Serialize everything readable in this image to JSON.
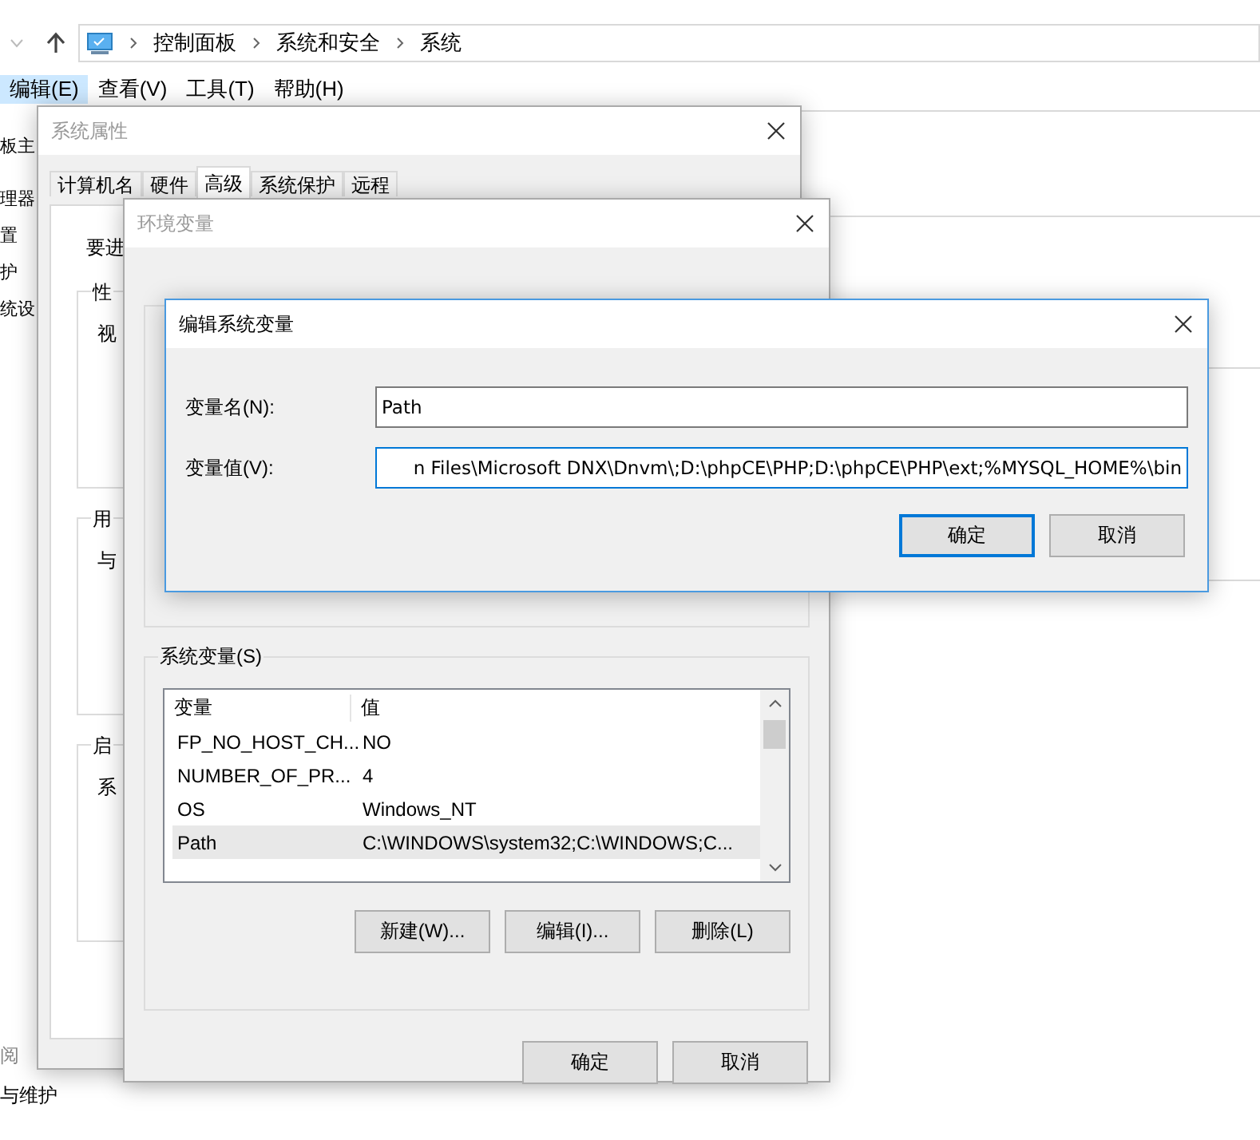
{
  "explorer": {
    "breadcrumb": [
      "控制面板",
      "系统和安全",
      "系统"
    ],
    "menu": [
      {
        "label": "编辑(E)",
        "selected": true
      },
      {
        "label": "查看(V)",
        "selected": false
      },
      {
        "label": "工具(T)",
        "selected": false
      },
      {
        "label": "帮助(H)",
        "selected": false
      }
    ],
    "sidebar_items": [
      "板主",
      "理器",
      "置",
      "护",
      "统设"
    ],
    "bottom_links": [
      "阅",
      "与维护"
    ]
  },
  "system_properties": {
    "title": "系统属性",
    "active": false,
    "tabs": [
      {
        "label": "计算机名",
        "selected": false
      },
      {
        "label": "硬件",
        "selected": false
      },
      {
        "label": "高级",
        "selected": true
      },
      {
        "label": "系统保护",
        "selected": false
      },
      {
        "label": "远程",
        "selected": false
      }
    ],
    "intro": "要进",
    "groups": [
      {
        "label": "性",
        "text": "视"
      },
      {
        "label": "用",
        "text": "与"
      },
      {
        "label": "启",
        "text": "系"
      }
    ]
  },
  "environment_variables": {
    "title": "环境变量",
    "active": false,
    "system_variables": {
      "label": "系统变量(S)",
      "columns": [
        "变量",
        "值"
      ],
      "rows": [
        {
          "name": "FP_NO_HOST_CH...",
          "value": "NO",
          "selected": false
        },
        {
          "name": "NUMBER_OF_PR...",
          "value": "4",
          "selected": false
        },
        {
          "name": "OS",
          "value": "Windows_NT",
          "selected": false
        },
        {
          "name": "Path",
          "value": "C:\\WINDOWS\\system32;C:\\WINDOWS;C...",
          "selected": true
        }
      ],
      "buttons": [
        "新建(W)...",
        "编辑(I)...",
        "删除(L)"
      ]
    },
    "buttons": [
      "确定",
      "取消"
    ]
  },
  "edit_dialog": {
    "title": "编辑系统变量",
    "active": true,
    "fields": [
      {
        "label": "变量名(N):",
        "value": "Path",
        "focused": false
      },
      {
        "label": "变量值(V):",
        "value": "n Files\\Microsoft DNX\\Dnvm\\;D:\\phpCE\\PHP;D:\\phpCE\\PHP\\ext;%MYSQL_HOME%\\bin",
        "focused": true
      }
    ],
    "buttons": [
      {
        "label": "确定",
        "default": true
      },
      {
        "label": "取消",
        "default": false
      }
    ]
  }
}
